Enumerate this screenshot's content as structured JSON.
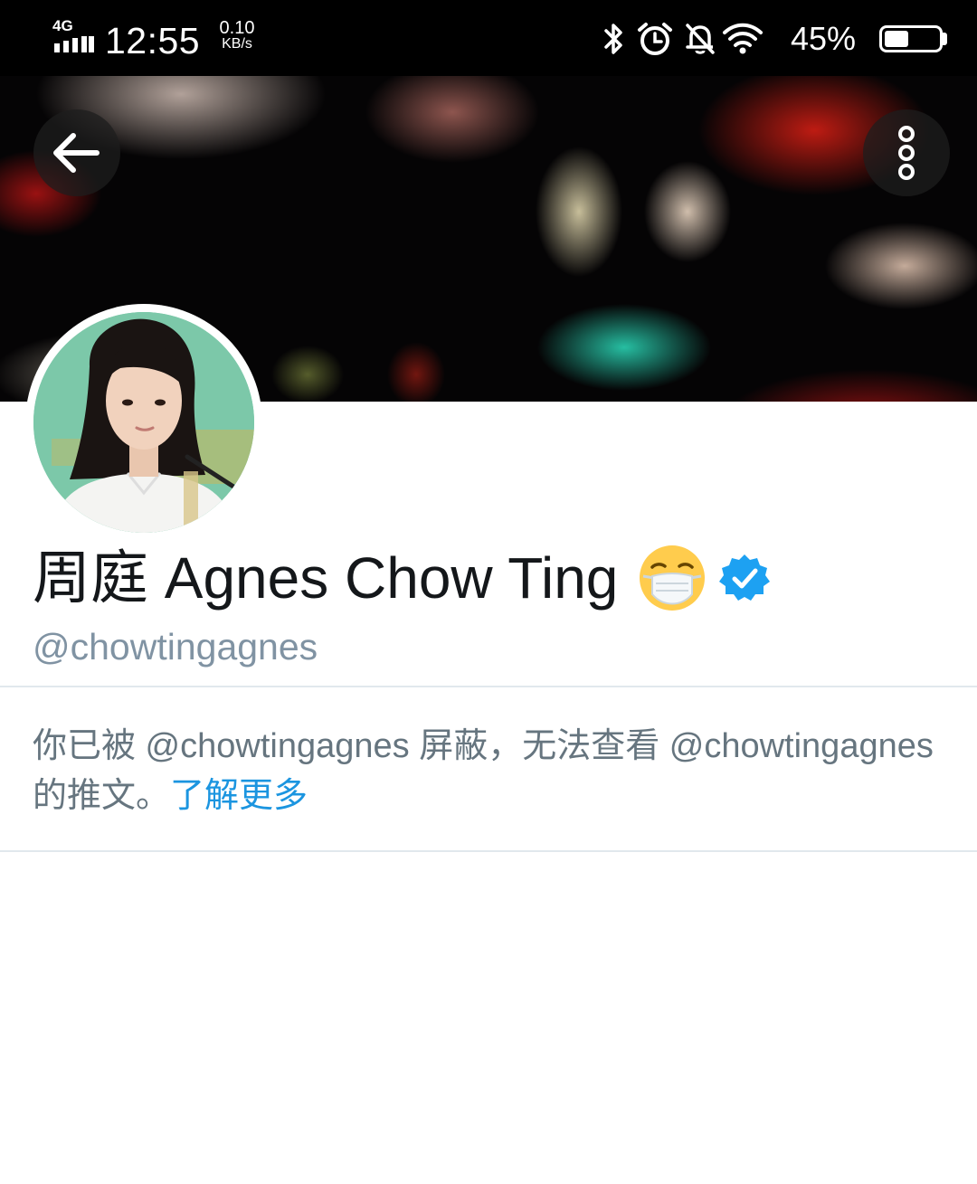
{
  "status_bar": {
    "network": "4G",
    "time": "12:55",
    "speed_value": "0.10",
    "speed_unit": "KB/s",
    "battery_percent": "45%",
    "battery_level": 0.45,
    "icons": [
      "signal-icon",
      "bluetooth-icon",
      "alarm-icon",
      "mute-bell-icon",
      "wifi-icon",
      "battery-icon"
    ]
  },
  "header": {
    "back_icon": "back-arrow-icon",
    "more_icon": "more-vertical-icon"
  },
  "profile": {
    "display_name": "周庭 Agnes Chow Ting",
    "emoji": "face-with-medical-mask",
    "verified": true,
    "handle": "@chowtingagnes"
  },
  "notice": {
    "text": "你已被 @chowtingagnes 屏蔽，无法查看 @chowtingagnes 的推文。",
    "link": "了解更多"
  },
  "colors": {
    "accent": "#1b95e0",
    "verified": "#1da1f2",
    "secondary_text": "#66757f",
    "handle_text": "#8093a3",
    "primary_text": "#14171a"
  }
}
